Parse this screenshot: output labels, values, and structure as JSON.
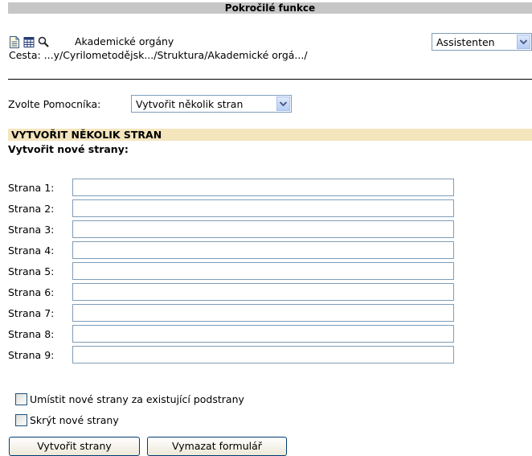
{
  "topbar": {
    "title": "Pokročilé funkce"
  },
  "header": {
    "icons": [
      "document-icon",
      "table-icon",
      "search-icon"
    ],
    "item_title": "Akademické orgány",
    "path": "Cesta: ...y/Cyrilometodějsk.../Struktura/Akademické orgá.../"
  },
  "assistant_select": {
    "value": "Assistenten"
  },
  "helper": {
    "label": "Zvolte Pomocníka:",
    "value": "Vytvořit několik stran"
  },
  "section": {
    "title": "VYTVOŘIT NĚKOLIK STRAN",
    "subtitle": "Vytvořit nové strany:"
  },
  "pages": [
    {
      "label": "Strana 1:",
      "value": ""
    },
    {
      "label": "Strana 2:",
      "value": ""
    },
    {
      "label": "Strana 3:",
      "value": ""
    },
    {
      "label": "Strana 4:",
      "value": ""
    },
    {
      "label": "Strana 5:",
      "value": ""
    },
    {
      "label": "Strana 6:",
      "value": ""
    },
    {
      "label": "Strana 7:",
      "value": ""
    },
    {
      "label": "Strana 8:",
      "value": ""
    },
    {
      "label": "Strana 9:",
      "value": ""
    }
  ],
  "options": [
    {
      "label": "Umístit nové strany za existující podstrany",
      "checked": false
    },
    {
      "label": "Skrýt nové strany",
      "checked": false
    }
  ],
  "buttons": {
    "create": "Vytvořit strany",
    "clear": "Vymazat formulář"
  }
}
